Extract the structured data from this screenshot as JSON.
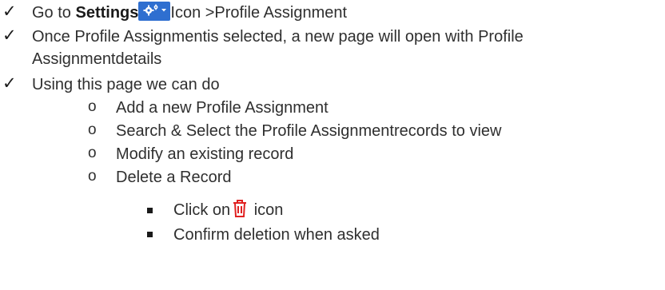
{
  "items": [
    {
      "prefix": "Go to ",
      "bold": "Settings",
      "icon": "settings-gear-dropdown-icon",
      "suffix": "Icon >Profile Assignment"
    },
    {
      "line1": "Once Profile Assignmentis selected, a new page will open with Profile",
      "line2": "Assignmentdetails"
    },
    {
      "text": "Using this page we can do",
      "subitems": [
        "Add a new Profile Assignment",
        "Search & Select the Profile Assignmentrecords to view",
        "Modify an existing record",
        "Delete a Record"
      ],
      "bullet_glyph": "o",
      "delete_steps": {
        "click_prefix": "Click on",
        "icon": "trash-icon",
        "click_suffix": "icon",
        "confirm": "Confirm deletion when asked"
      }
    }
  ],
  "colors": {
    "settings_button": "#2f6fd0",
    "trash_icon": "#e02020"
  }
}
